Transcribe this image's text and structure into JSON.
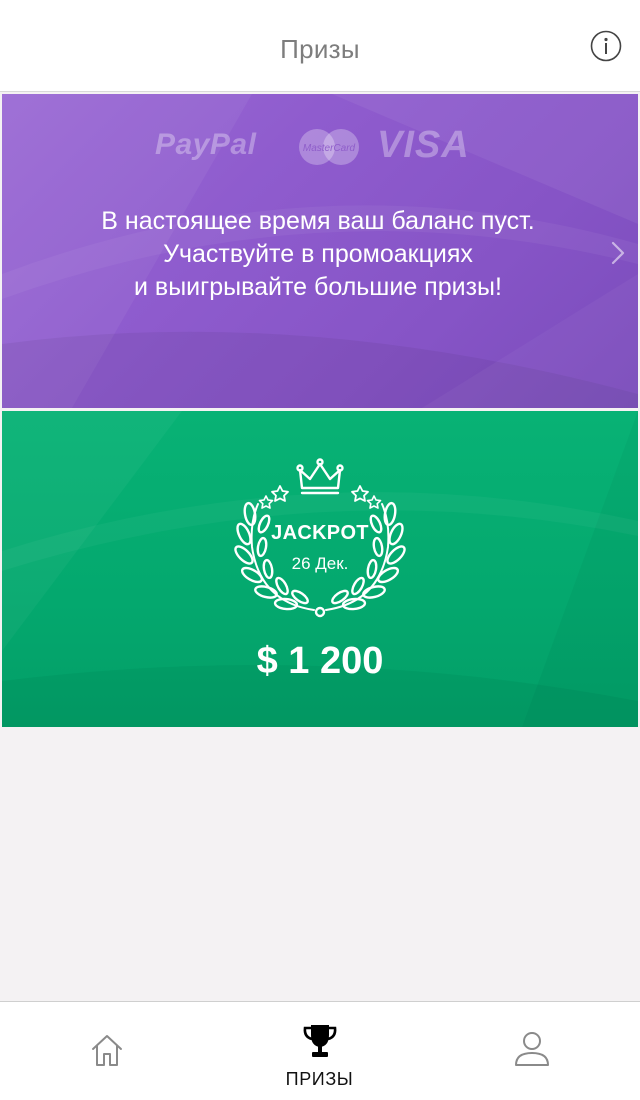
{
  "header": {
    "title": "Призы",
    "info_icon": "info-circle-icon"
  },
  "balance_card": {
    "logos": {
      "paypal": "PayPal",
      "mastercard": "MasterCard",
      "visa": "VISA"
    },
    "message_lines": [
      "В настоящее время ваш баланс пуст.",
      "Участвуйте в промоакциях",
      "и выигрывайте большие призы!"
    ],
    "chevron_icon": "chevron-right-icon",
    "colors": {
      "background": "#8f5cce"
    }
  },
  "jackpot_card": {
    "label": "JACKPOT",
    "date": "26 Дек.",
    "amount": "$ 1 200",
    "icon": "laurel-wreath-crown-icon",
    "colors": {
      "background": "#04a86e"
    }
  },
  "tab_bar": {
    "tabs": [
      {
        "id": "home",
        "icon": "home-icon",
        "label": "",
        "active": false
      },
      {
        "id": "prizes",
        "icon": "trophy-icon",
        "label": "ПРИЗЫ",
        "active": true
      },
      {
        "id": "profile",
        "icon": "user-icon",
        "label": "",
        "active": false
      }
    ]
  },
  "colors": {
    "page_background": "#f4f2f3",
    "header_title": "#7d7d7d",
    "tab_inactive": "#8a8a8a",
    "tab_active": "#000000"
  }
}
